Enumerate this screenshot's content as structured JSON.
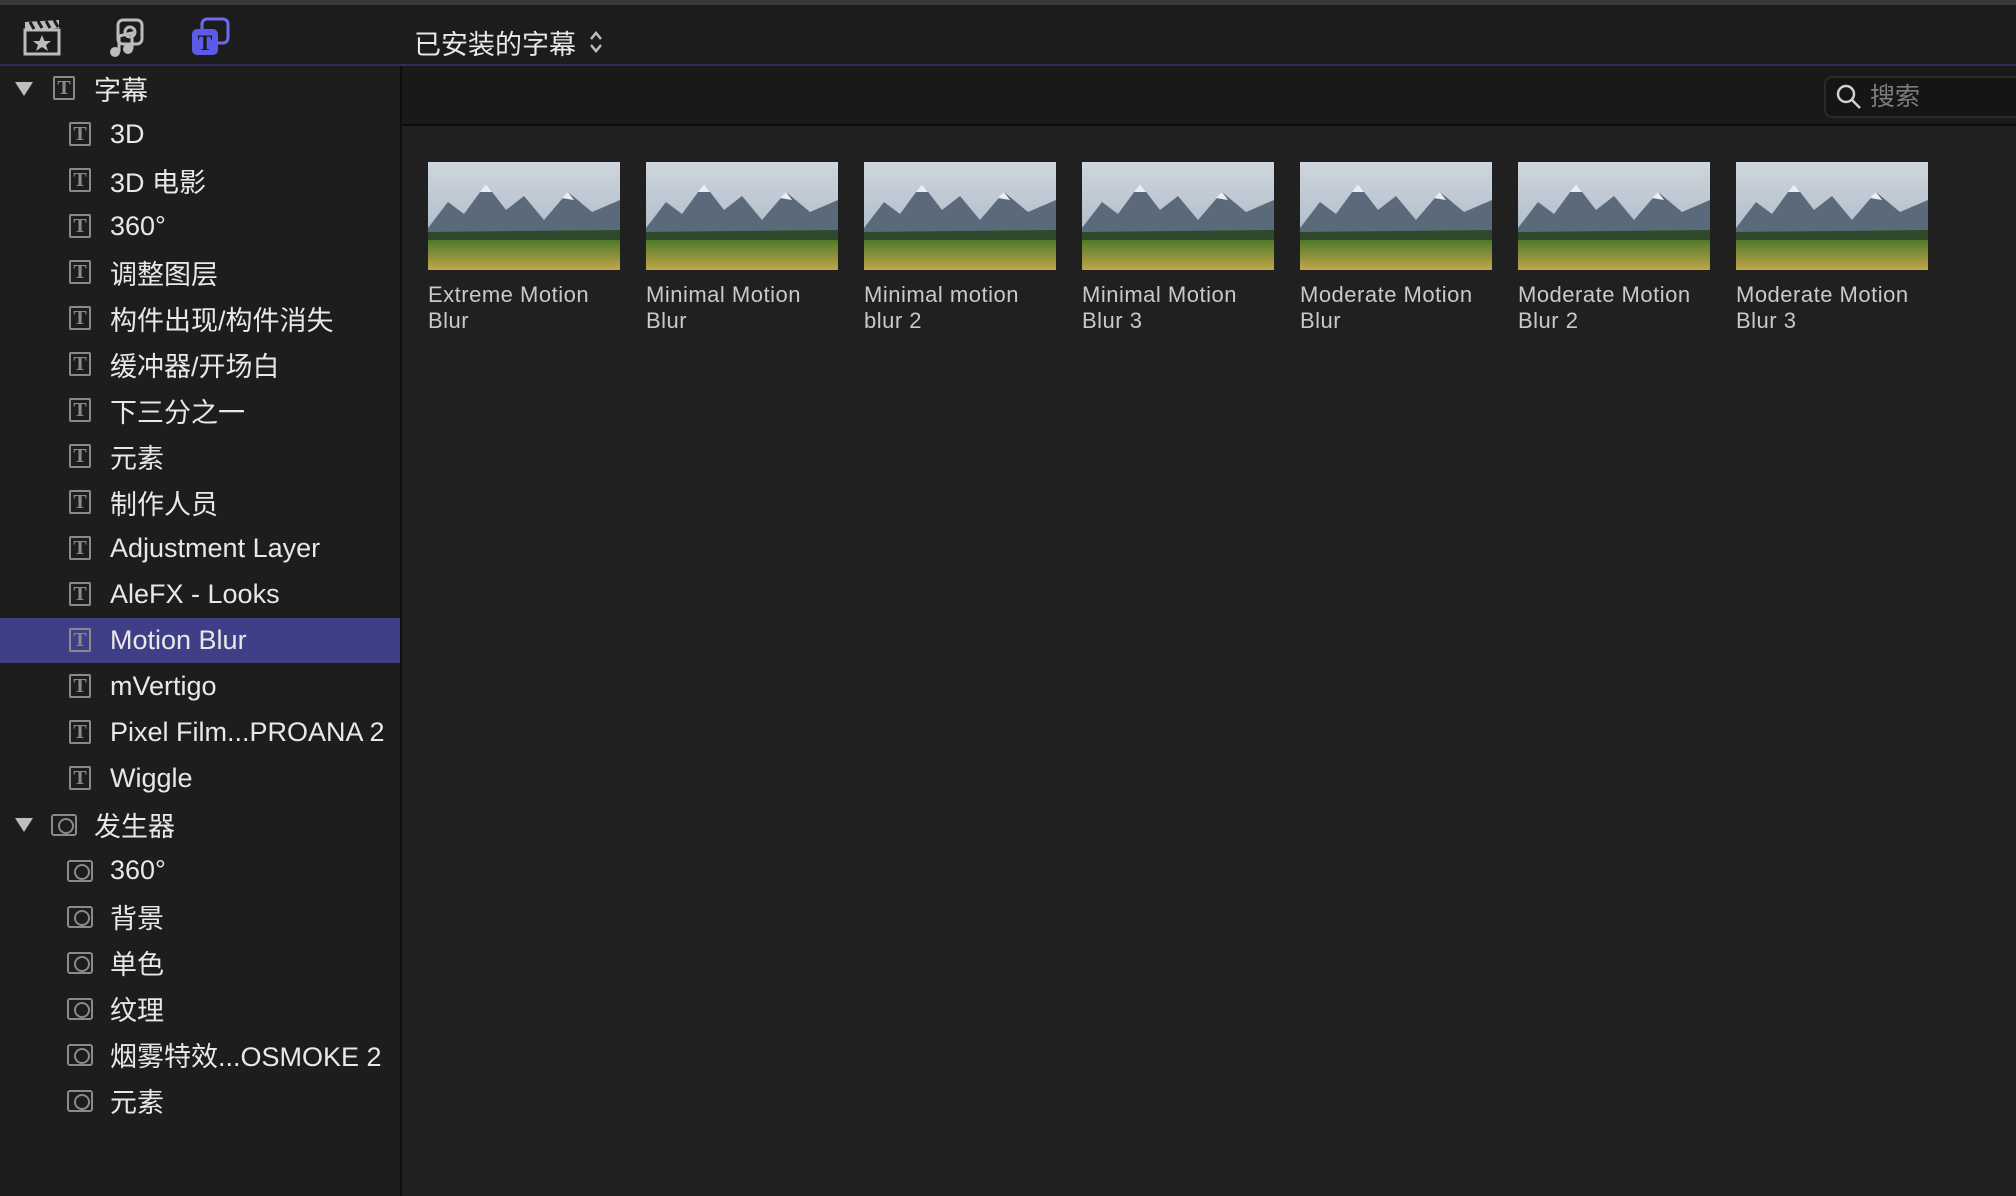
{
  "toolbar": {
    "icons": [
      "clapboard-star-icon",
      "music-photo-icon",
      "titles-generators-icon"
    ],
    "popup_label": "已安装的字幕",
    "popup_icon": "up-down-chevron-icon",
    "accent_color": "#6b6bf0"
  },
  "sidebar": {
    "selected_color": "#3e3f86",
    "sections": [
      {
        "label": "字幕",
        "icon": "title-icon",
        "expanded": true,
        "items": [
          "3D",
          "3D 电影",
          "360°",
          "调整图层",
          "构件出现/构件消失",
          "缓冲器/开场白",
          "下三分之一",
          "元素",
          "制作人员",
          "Adjustment Layer",
          "AleFX - Looks",
          "Motion Blur",
          "mVertigo",
          "Pixel Film...PROANA 2",
          "Wiggle"
        ]
      },
      {
        "label": "发生器",
        "icon": "generator-icon",
        "expanded": true,
        "items": [
          "360°",
          "背景",
          "单色",
          "纹理",
          "烟雾特效...OSMOKE 2",
          "元素"
        ]
      }
    ],
    "selected_item": "Motion Blur"
  },
  "search": {
    "placeholder": "搜索",
    "value": ""
  },
  "browser": {
    "items": [
      {
        "line1": "Extreme Motion",
        "line2": "Blur"
      },
      {
        "line1": "Minimal Motion",
        "line2": "Blur"
      },
      {
        "line1": "Minimal motion",
        "line2": "blur 2"
      },
      {
        "line1": "Minimal Motion",
        "line2": "Blur 3"
      },
      {
        "line1": "Moderate Motion",
        "line2": "Blur"
      },
      {
        "line1": "Moderate Motion",
        "line2": "Blur 2"
      },
      {
        "line1": "Moderate Motion",
        "line2": "Blur 3"
      }
    ]
  }
}
